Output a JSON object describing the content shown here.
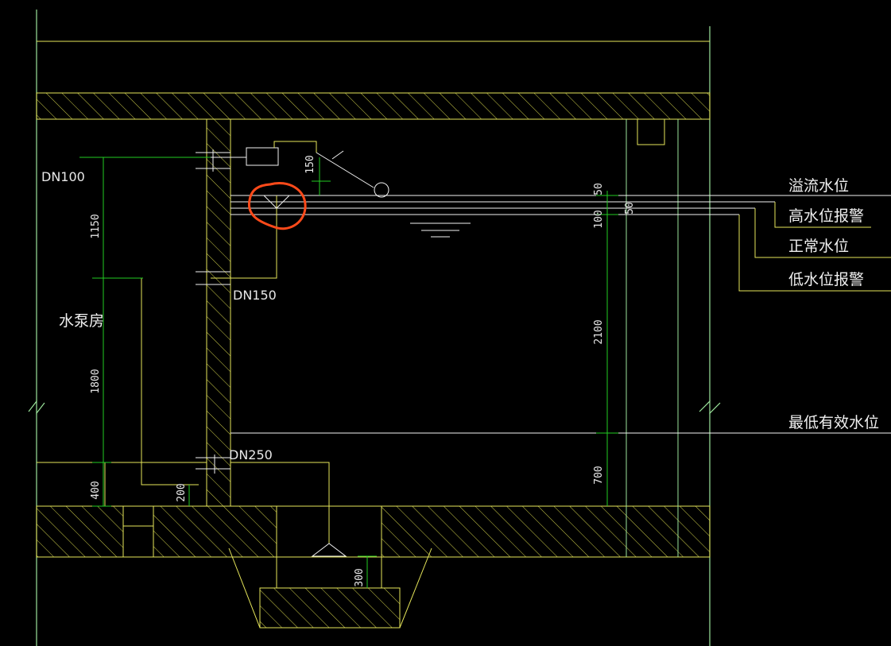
{
  "colors": {
    "background": "#000000",
    "structure": "#e6e65a",
    "dimension": "#22cc22",
    "outline": "#9be59b",
    "text": "#e8e8e8",
    "water_line": "#f2f2f2",
    "markup_circle": "#ff4a1a"
  },
  "pipes": {
    "inlet": "DN100",
    "overflow": "DN150",
    "suction": "DN250"
  },
  "rooms": {
    "pump_room": "水泵房"
  },
  "dimensions": {
    "d1150": "1150",
    "d1800": "1800",
    "d400": "400",
    "d200": "200",
    "d150": "150",
    "d50a": "50",
    "d50b": "50",
    "d100": "100",
    "d2100": "2100",
    "d700": "700",
    "d300": "300"
  },
  "levels": {
    "overflow": "溢流水位",
    "high_alarm": "高水位报警",
    "normal": "正常水位",
    "low_alarm": "低水位报警",
    "min_effective": "最低有效水位"
  }
}
